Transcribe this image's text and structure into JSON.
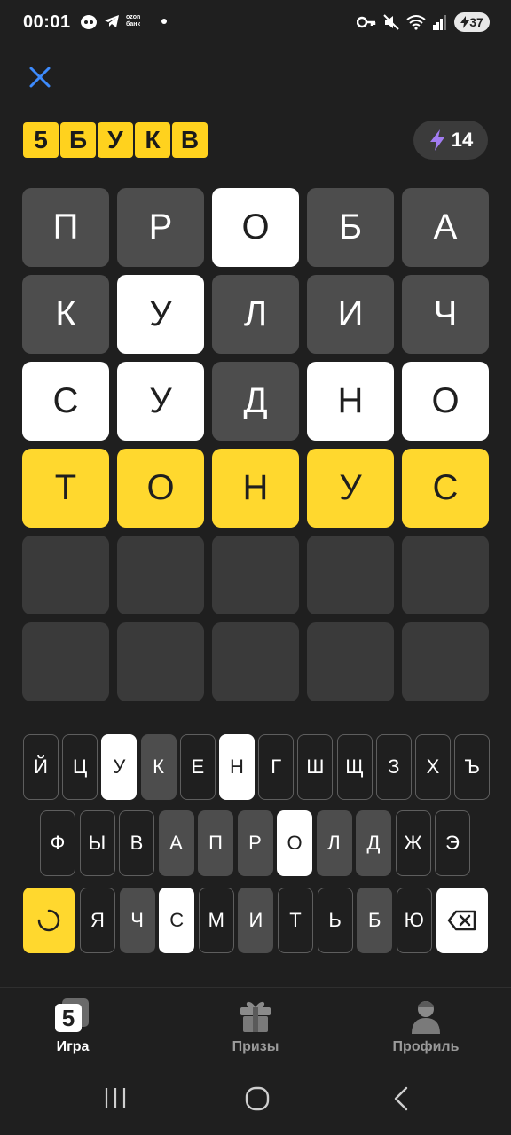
{
  "status_bar": {
    "time": "00:01",
    "ozon_label": "ozon банк",
    "battery": "37"
  },
  "header": {
    "logo_letters": [
      "5",
      "Б",
      "У",
      "К",
      "В"
    ],
    "energy_count": "14"
  },
  "board": [
    [
      {
        "l": "П",
        "s": "absent"
      },
      {
        "l": "Р",
        "s": "absent"
      },
      {
        "l": "О",
        "s": "present"
      },
      {
        "l": "Б",
        "s": "absent"
      },
      {
        "l": "А",
        "s": "absent"
      }
    ],
    [
      {
        "l": "К",
        "s": "absent"
      },
      {
        "l": "У",
        "s": "present"
      },
      {
        "l": "Л",
        "s": "absent"
      },
      {
        "l": "И",
        "s": "absent"
      },
      {
        "l": "Ч",
        "s": "absent"
      }
    ],
    [
      {
        "l": "С",
        "s": "present"
      },
      {
        "l": "У",
        "s": "present"
      },
      {
        "l": "Д",
        "s": "absent"
      },
      {
        "l": "Н",
        "s": "present"
      },
      {
        "l": "О",
        "s": "present"
      }
    ],
    [
      {
        "l": "Т",
        "s": "correct"
      },
      {
        "l": "О",
        "s": "correct"
      },
      {
        "l": "Н",
        "s": "correct"
      },
      {
        "l": "У",
        "s": "correct"
      },
      {
        "l": "С",
        "s": "correct"
      }
    ],
    [
      {
        "l": "",
        "s": "empty"
      },
      {
        "l": "",
        "s": "empty"
      },
      {
        "l": "",
        "s": "empty"
      },
      {
        "l": "",
        "s": "empty"
      },
      {
        "l": "",
        "s": "empty"
      }
    ],
    [
      {
        "l": "",
        "s": "empty"
      },
      {
        "l": "",
        "s": "empty"
      },
      {
        "l": "",
        "s": "empty"
      },
      {
        "l": "",
        "s": "empty"
      },
      {
        "l": "",
        "s": "empty"
      }
    ]
  ],
  "keyboard": {
    "row1": [
      {
        "k": "Й",
        "s": "unused"
      },
      {
        "k": "Ц",
        "s": "unused"
      },
      {
        "k": "У",
        "s": "present"
      },
      {
        "k": "К",
        "s": "absent"
      },
      {
        "k": "Е",
        "s": "unused"
      },
      {
        "k": "Н",
        "s": "present"
      },
      {
        "k": "Г",
        "s": "unused"
      },
      {
        "k": "Ш",
        "s": "unused"
      },
      {
        "k": "Щ",
        "s": "unused"
      },
      {
        "k": "З",
        "s": "unused"
      },
      {
        "k": "Х",
        "s": "unused"
      },
      {
        "k": "Ъ",
        "s": "unused"
      }
    ],
    "row2": [
      {
        "k": "Ф",
        "s": "unused"
      },
      {
        "k": "Ы",
        "s": "unused"
      },
      {
        "k": "В",
        "s": "unused"
      },
      {
        "k": "А",
        "s": "absent"
      },
      {
        "k": "П",
        "s": "absent"
      },
      {
        "k": "Р",
        "s": "absent"
      },
      {
        "k": "О",
        "s": "present"
      },
      {
        "k": "Л",
        "s": "absent"
      },
      {
        "k": "Д",
        "s": "absent"
      },
      {
        "k": "Ж",
        "s": "unused"
      },
      {
        "k": "Э",
        "s": "unused"
      }
    ],
    "row3": [
      {
        "k": "Я",
        "s": "unused"
      },
      {
        "k": "Ч",
        "s": "absent"
      },
      {
        "k": "С",
        "s": "present"
      },
      {
        "k": "М",
        "s": "unused"
      },
      {
        "k": "И",
        "s": "absent"
      },
      {
        "k": "Т",
        "s": "unused"
      },
      {
        "k": "Ь",
        "s": "unused"
      },
      {
        "k": "Б",
        "s": "absent"
      },
      {
        "k": "Ю",
        "s": "unused"
      }
    ]
  },
  "bottom_nav": [
    {
      "label": "Игра",
      "icon": "game-icon",
      "active": true
    },
    {
      "label": "Призы",
      "icon": "gift-icon",
      "active": false
    },
    {
      "label": "Профиль",
      "icon": "profile-icon",
      "active": false
    }
  ],
  "colors": {
    "background": "#1f1f1f",
    "absent": "#4d4d4d",
    "present": "#ffffff",
    "correct": "#ffd82e",
    "empty": "#3a3a3a",
    "accent_close": "#3d8bfd",
    "energy_bolt": "#a27cf2"
  }
}
